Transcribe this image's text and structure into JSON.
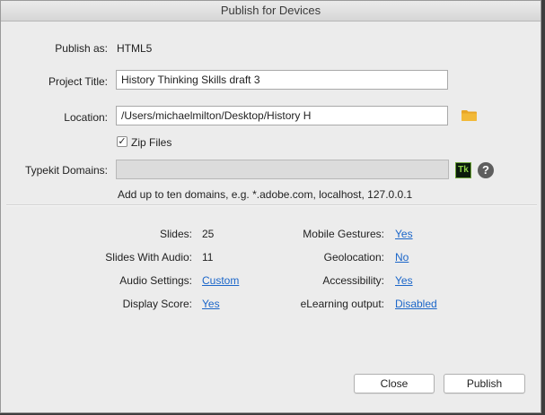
{
  "window": {
    "title": "Publish for Devices"
  },
  "form": {
    "publish_as_label": "Publish as:",
    "publish_as_value": "HTML5",
    "project_title_label": "Project Title:",
    "project_title_value": "History Thinking Skills draft 3",
    "location_label": "Location:",
    "location_value": "/Users/michaelmilton/Desktop/History H",
    "zip_files_label": "Zip Files",
    "zip_files_checked": true,
    "typekit_label": "Typekit Domains:",
    "typekit_value": "",
    "typekit_badge": "Tk",
    "help_glyph": "?",
    "typekit_hint": "Add up to ten domains, e.g. *.adobe.com, localhost, 127.0.0.1"
  },
  "summary": {
    "left": [
      {
        "label": "Slides:",
        "value": "25",
        "is_link": false
      },
      {
        "label": "Slides With Audio:",
        "value": "11",
        "is_link": false
      },
      {
        "label": "Audio Settings:",
        "value": "Custom",
        "is_link": true
      },
      {
        "label": "Display Score:",
        "value": "Yes",
        "is_link": true
      }
    ],
    "right": [
      {
        "label": "Mobile Gestures:",
        "value": "Yes",
        "is_link": true
      },
      {
        "label": "Geolocation:",
        "value": "No",
        "is_link": true
      },
      {
        "label": "Accessibility:",
        "value": "Yes",
        "is_link": true
      },
      {
        "label": "eLearning output:",
        "value": "Disabled",
        "is_link": true
      }
    ]
  },
  "buttons": {
    "close_label": "Close",
    "publish_label": "Publish"
  },
  "icons": {
    "folder": "folder-icon",
    "typekit": "typekit-icon",
    "help": "help-icon"
  },
  "colors": {
    "link": "#1b66c9",
    "folder": "#e8a628",
    "typekit_fg": "#8fd14a"
  }
}
